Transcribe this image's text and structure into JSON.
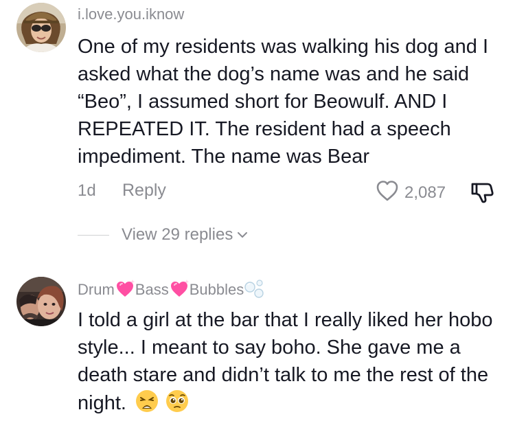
{
  "comments": [
    {
      "username": "i.love.you.iknow",
      "text": "One of my residents was walking his dog and I asked what the dog’s name was and he said “Beo”, I assumed short for Beowulf. AND I REPEATED IT. The resident had a speech impediment. The name was Bear",
      "age": "1d",
      "reply_label": "Reply",
      "likes": "2,087",
      "view_replies_label": "View 29 replies"
    },
    {
      "username_parts": [
        "Drum",
        "Bass",
        "Bubbles"
      ],
      "text": "I told a girl at the bar that I really liked her hobo style... I meant to say boho. She gave me a death stare and didn’t talk to me the rest of the night."
    }
  ],
  "icons": {
    "like": "heart-outline-icon",
    "dislike": "thumbs-down-icon",
    "chevron": "chevron-down-icon",
    "sparkle_heart": "sparkling-heart-emoji",
    "bubbles": "bubbles-emoji",
    "weary_face": "weary-face-emoji",
    "pleading_face": "pleading-face-emoji"
  },
  "colors": {
    "text": "#161823",
    "secondary": "#8a8b91",
    "heart_emoji": "#ff4fa3"
  }
}
